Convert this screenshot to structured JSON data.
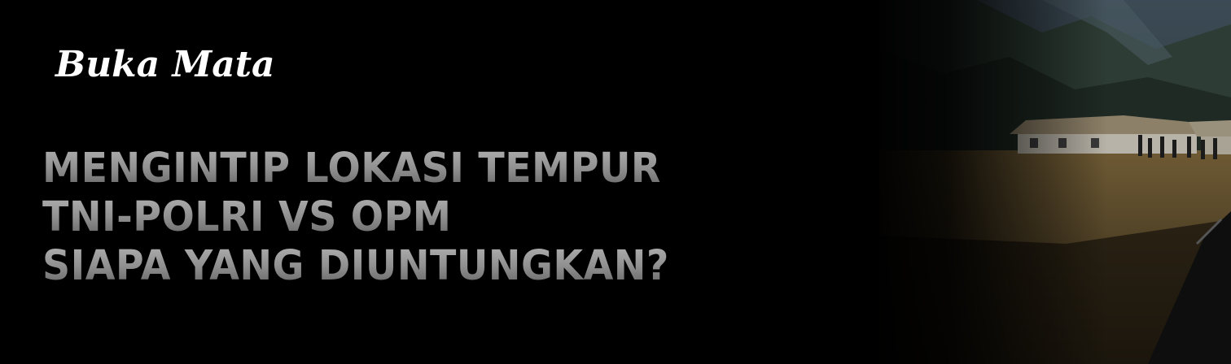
{
  "banner": {
    "logo_text": "Buka Mata",
    "headline": {
      "line1": "MENGINTIP LOKASI TEMPUR",
      "line2": "TNI-POLRI VS OPM",
      "line3": "SIAPA YANG DIUNTUNGKAN?"
    }
  },
  "colors": {
    "background": "#000000",
    "headline_top": "#b3b3b3",
    "headline_bottom": "#5c5c5c",
    "logo": "#ffffff"
  }
}
